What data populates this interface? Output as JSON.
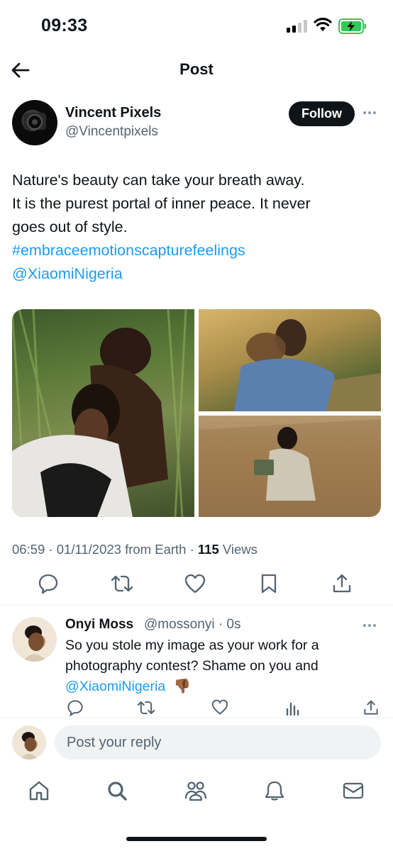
{
  "status_bar": {
    "time": "09:33",
    "signal_icon": "cellular-signal-icon",
    "wifi_icon": "wifi-icon",
    "battery_icon": "battery-charging-icon",
    "battery_color": "#34c759"
  },
  "header": {
    "back_icon": "arrow-left-icon",
    "title": "Post"
  },
  "post": {
    "author": {
      "name": "Vincent Pixels",
      "handle": "@Vincentpixels"
    },
    "follow_label": "Follow",
    "text_lines": [
      "Nature's beauty can take your breath away.",
      "It is the purest portal of inner peace. It never",
      "goes out of style."
    ],
    "hashtag": "#embraceemotionscapturefeelings",
    "mention": "@XiaomiNigeria",
    "meta": {
      "time_date": "06:59 · 01/11/2023 from Earth · ",
      "views_count": "115",
      "views_label": " Views"
    },
    "actions": [
      "reply-icon",
      "repost-icon",
      "like-icon",
      "bookmark-icon",
      "share-icon"
    ]
  },
  "reply": {
    "name": "Onyi Moss",
    "handle": "@mossonyi · 0s",
    "text": "So you stole my image as your work for a photography contest? Shame on you and ",
    "mention": "@XiaomiNigeria",
    "emoji": "👎🏾",
    "actions": [
      "reply-icon",
      "repost-icon",
      "like-icon",
      "views-icon",
      "share-icon"
    ]
  },
  "composer": {
    "placeholder": "Post your reply"
  },
  "tabbar": {
    "tabs": [
      "home-icon",
      "search-icon",
      "communities-icon",
      "notifications-icon",
      "messages-icon"
    ]
  },
  "colors": {
    "accent": "#1d9bf0",
    "text": "#0f1419",
    "secondary": "#536471"
  }
}
